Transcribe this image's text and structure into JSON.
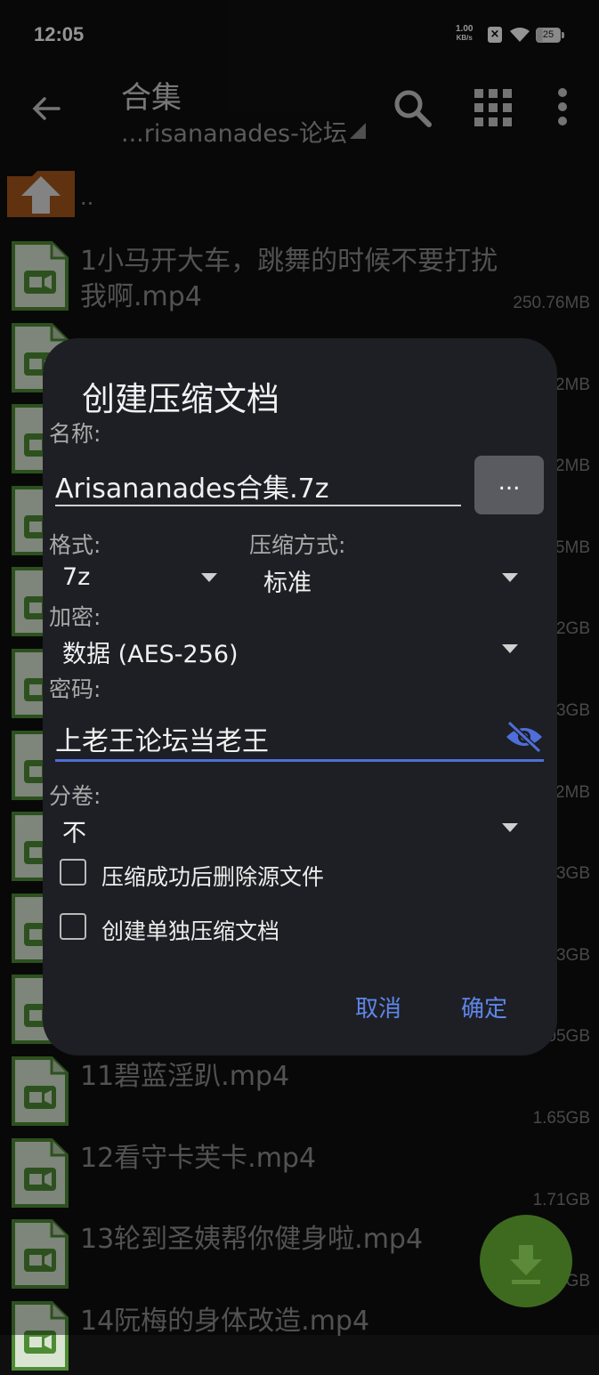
{
  "status_bar": {
    "time": "12:05",
    "speed_value": "1.00",
    "speed_unit": "KB/s",
    "battery": "25"
  },
  "toolbar": {
    "title": "合集",
    "subtitle": "...risananades-论坛"
  },
  "file_list": {
    "parent_dir_label": "..",
    "items": [
      {
        "name": "1小马开大车，跳舞的时候不要打扰我啊.mp4",
        "size": "250.76MB"
      },
      {
        "name": "",
        "size": "2MB"
      },
      {
        "name": "",
        "size": "2MB"
      },
      {
        "name": "",
        "size": "5MB"
      },
      {
        "name": "",
        "size": "2GB"
      },
      {
        "name": "",
        "size": "3GB"
      },
      {
        "name": "",
        "size": "2MB"
      },
      {
        "name": "",
        "size": "3GB"
      },
      {
        "name": "",
        "size": "3GB"
      },
      {
        "name": "",
        "size": "05GB"
      },
      {
        "name": "11碧蓝淫趴.mp4",
        "size": "1.65GB"
      },
      {
        "name": "12看守卡芙卡.mp4",
        "size": "1.71GB"
      },
      {
        "name": "13轮到圣姨帮你健身啦.mp4",
        "size": "GB"
      },
      {
        "name": "14阮梅的身体改造.mp4",
        "size": ""
      }
    ]
  },
  "dialog": {
    "title": "创建压缩文档",
    "name_label": "名称:",
    "name_value": "Arisananades合集.7z",
    "browse_label": "...",
    "format_label": "格式:",
    "format_value": "7z",
    "method_label": "压缩方式:",
    "method_value": "标准",
    "encryption_label": "加密:",
    "encryption_value": "数据 (AES-256)",
    "password_label": "密码:",
    "password_value": "上老王论坛当老王",
    "split_label": "分卷:",
    "split_value": "不",
    "option_delete_source": "压缩成功后删除源文件",
    "option_separate_archive": "创建单独压缩文档",
    "cancel_label": "取消",
    "ok_label": "确定"
  },
  "colors": {
    "accent_blue": "#5e86e8",
    "fab_green": "#3e6a1f",
    "dialog_bg": "#1e1f24"
  }
}
